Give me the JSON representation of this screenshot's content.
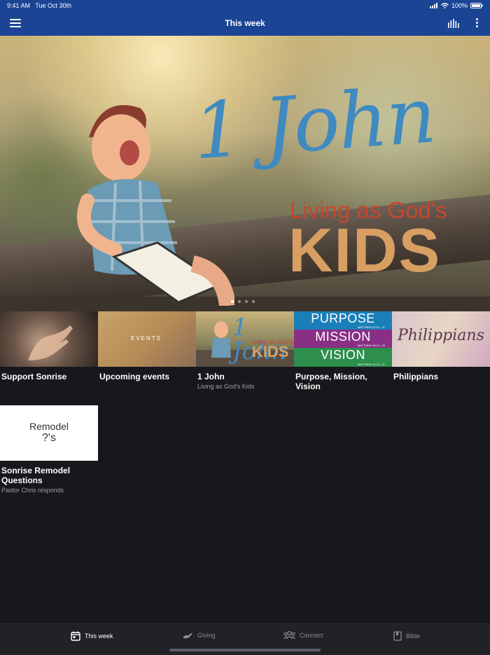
{
  "status": {
    "time": "9:41 AM",
    "date": "Tue Oct 30th",
    "battery": "100%"
  },
  "nav": {
    "title": "This week"
  },
  "hero": {
    "title": "1 John",
    "subtitle": "Living as God's",
    "kids": "KIDS",
    "pages": 4,
    "current_page": 1
  },
  "cards": [
    {
      "title": "Support Sonrise",
      "subtitle": ""
    },
    {
      "title": "Upcoming events",
      "subtitle": "",
      "thumb_text": "EVENTS"
    },
    {
      "title": "1 John",
      "subtitle": "Living as God's Kids",
      "thumb_title": "1 John",
      "thumb_sub": "Living as God's",
      "thumb_kids": "KIDS"
    },
    {
      "title": "Purpose, Mission, Vision",
      "subtitle": "",
      "bands": [
        {
          "label": "PURPOSE",
          "ref": "MATTHEW 22:34 - 37",
          "color": "#1a7fb8"
        },
        {
          "label": "MISSION",
          "ref": "MATTHEW 28:18 - 20",
          "color": "#8a2f86"
        },
        {
          "label": "VISION",
          "ref": "MATTHEW 14:15 - 21",
          "color": "#2e8f4c"
        }
      ]
    },
    {
      "title": "Philippians",
      "subtitle": "",
      "thumb_text": "Philippians"
    },
    {
      "title": "Sonrise Remodel Questions",
      "subtitle": "Pastor Chris responds",
      "thumb_line1": "Remodel",
      "thumb_line2": "?'s"
    }
  ],
  "tabs": [
    {
      "label": "This week",
      "icon": "calendar-icon",
      "active": true
    },
    {
      "label": "Giving",
      "icon": "giving-hand-icon",
      "active": false
    },
    {
      "label": "Connect",
      "icon": "people-icon",
      "active": false
    },
    {
      "label": "Bible",
      "icon": "book-icon",
      "active": false
    }
  ]
}
